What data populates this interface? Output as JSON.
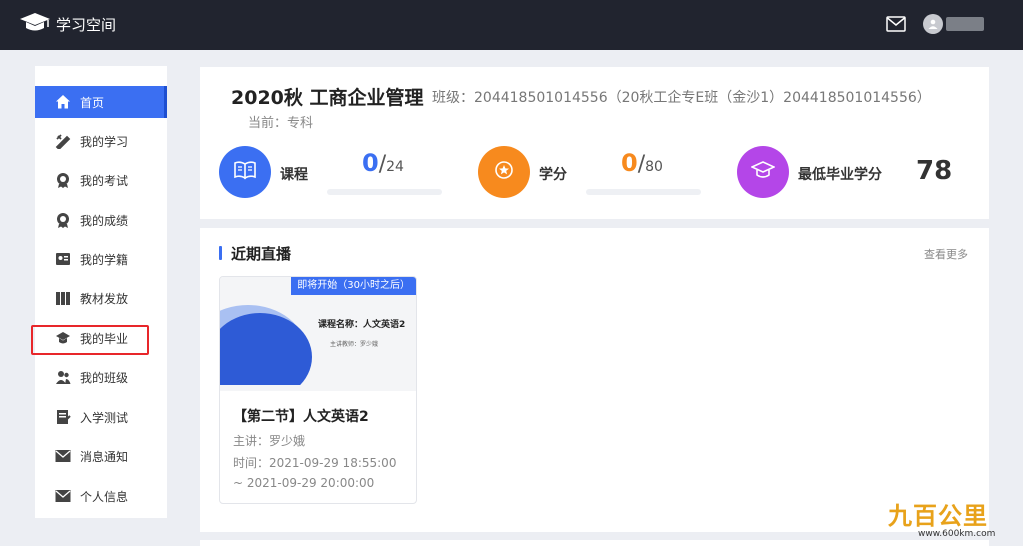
{
  "header": {
    "app_name": "学习空间"
  },
  "sidebar": {
    "items": [
      {
        "label": "首页",
        "icon": "home-icon",
        "active": true
      },
      {
        "label": "我的学习",
        "icon": "study-icon"
      },
      {
        "label": "我的考试",
        "icon": "exam-medal-icon"
      },
      {
        "label": "我的成绩",
        "icon": "grade-medal-icon"
      },
      {
        "label": "我的学籍",
        "icon": "student-card-icon"
      },
      {
        "label": "教材发放",
        "icon": "books-icon"
      },
      {
        "label": "我的毕业",
        "icon": "graduation-cap-icon"
      },
      {
        "label": "我的班级",
        "icon": "class-users-icon"
      },
      {
        "label": "入学测试",
        "icon": "test-doc-icon"
      },
      {
        "label": "消息通知",
        "icon": "envelope-icon"
      },
      {
        "label": "个人信息",
        "icon": "personal-envelope-icon"
      }
    ]
  },
  "info": {
    "course_title": "2020秋 工商企业管理",
    "class_info": "班级：204418501014556（20秋工企专E班（金沙1）204418501014556）",
    "current": "当前：专科",
    "stats": [
      {
        "label": "课程",
        "value": "0",
        "total": "24",
        "color": "#3b6ff2",
        "icon": "book-icon"
      },
      {
        "label": "学分",
        "value": "0",
        "total": "80",
        "color": "#f78a1e",
        "icon": "star-coin-icon"
      },
      {
        "label": "最低毕业学分",
        "value": "78",
        "color": "#b446e8",
        "icon": "graduation-cap-icon"
      }
    ]
  },
  "live": {
    "section_title": "近期直播",
    "more_label": "查看更多",
    "lessons": [
      {
        "badge": "即将开始（30小时之后）",
        "thumb_course_name": "课程名称：人文英语2",
        "thumb_teacher": "主讲教师：罗少娥",
        "title": "【第二节】人文英语2",
        "teacher": "主讲：罗少娥",
        "time": "时间：2021-09-29 18:55:00 ~ 2021-09-29 20:00:00"
      }
    ]
  },
  "watermark": {
    "logo": "九百公里",
    "url": "www.600km.com"
  },
  "colors": {
    "topbar": "#21242f",
    "accent": "#3b6ff2",
    "highlight": "#e8262a"
  }
}
